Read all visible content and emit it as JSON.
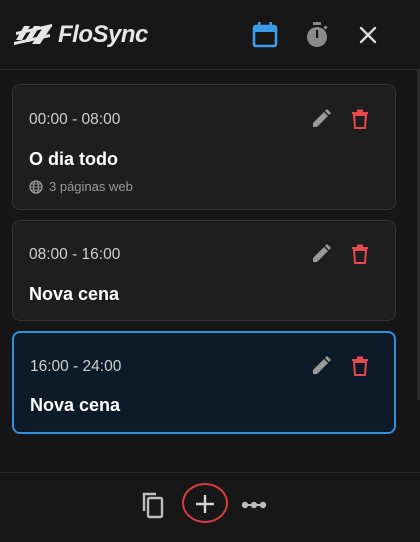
{
  "header": {
    "brand": "FloSync",
    "icons": [
      "calendar-icon",
      "stopwatch-icon",
      "close-icon"
    ]
  },
  "colors": {
    "accent": "#3d9be9",
    "delete": "#e5484d",
    "active_border": "#2f8fe0",
    "highlight_ring": "#d63c3c"
  },
  "scenes": [
    {
      "time": "00:00 - 08:00",
      "title": "O dia todo",
      "subtitle": "3 páginas web",
      "active": false
    },
    {
      "time": "08:00 - 16:00",
      "title": "Nova cena",
      "subtitle": "",
      "active": false
    },
    {
      "time": "16:00 - 24:00",
      "title": "Nova cena",
      "subtitle": "",
      "active": true
    }
  ],
  "footer": {
    "icons": [
      "copy-icon",
      "plus-icon",
      "more-icon"
    ]
  }
}
